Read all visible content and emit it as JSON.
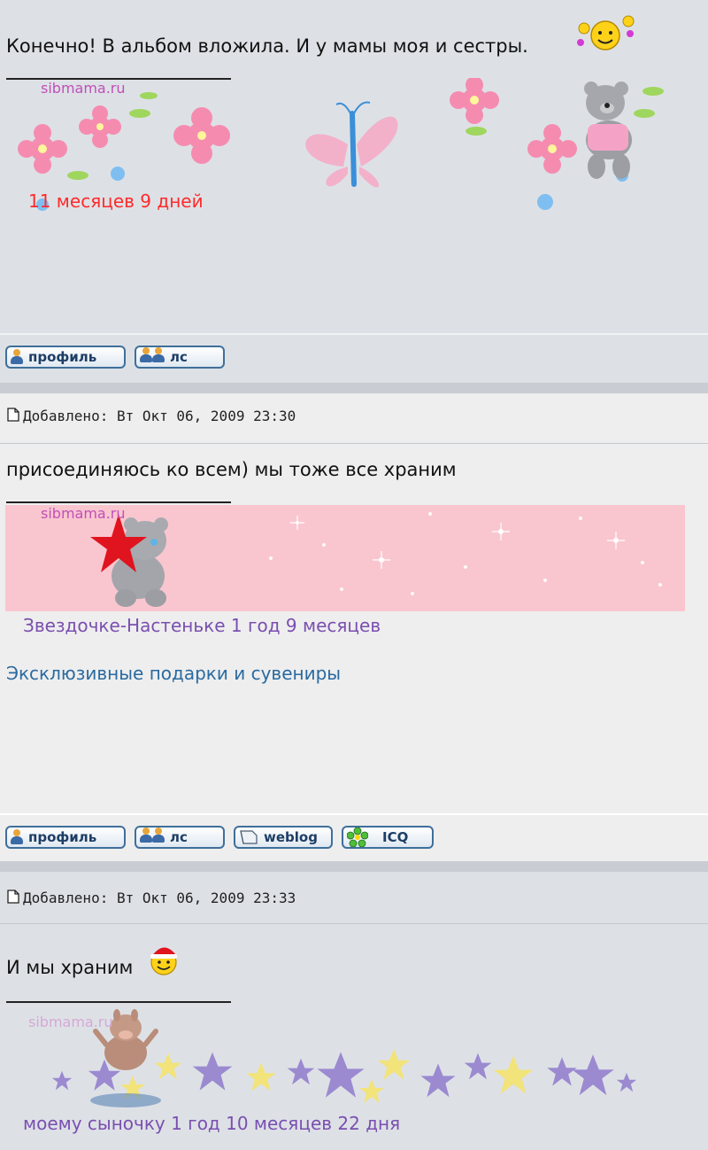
{
  "posts": [
    {
      "message": "Конечно! В альбом вложила. И у мамы моя и сестры.",
      "signature": {
        "watermark": "sibmama.ru",
        "caption": "11 месяцев 9 дней",
        "caption_color": "#ff2a2a"
      }
    },
    {
      "meta": "Добавлено: Вт Окт 06, 2009 23:30",
      "message": "присоединяюсь ко всем) мы тоже все храним",
      "signature": {
        "watermark": "sibmama.ru",
        "caption": "Звездочке-Настеньке 1 год 9 месяцев",
        "caption_color": "#7a4fb0",
        "link": "Эксклюзивные подарки и сувениры",
        "link_color": "#2a6aa0"
      }
    },
    {
      "meta": "Добавлено: Вт Окт 06, 2009 23:33",
      "message": "И мы храним",
      "signature": {
        "watermark": "sibmama.ru",
        "caption": "моему сыночку 1 год 10 месяцев 22 дня",
        "caption_color": "#7a4fb0"
      }
    }
  ],
  "buttons": {
    "profile": "профиль",
    "pm": "лс",
    "weblog": "weblog",
    "icq": "ICQ"
  },
  "colors": {
    "post_dark": "#dde1e6",
    "post_light": "#eeeeee",
    "button_text": "#1d3e66"
  }
}
